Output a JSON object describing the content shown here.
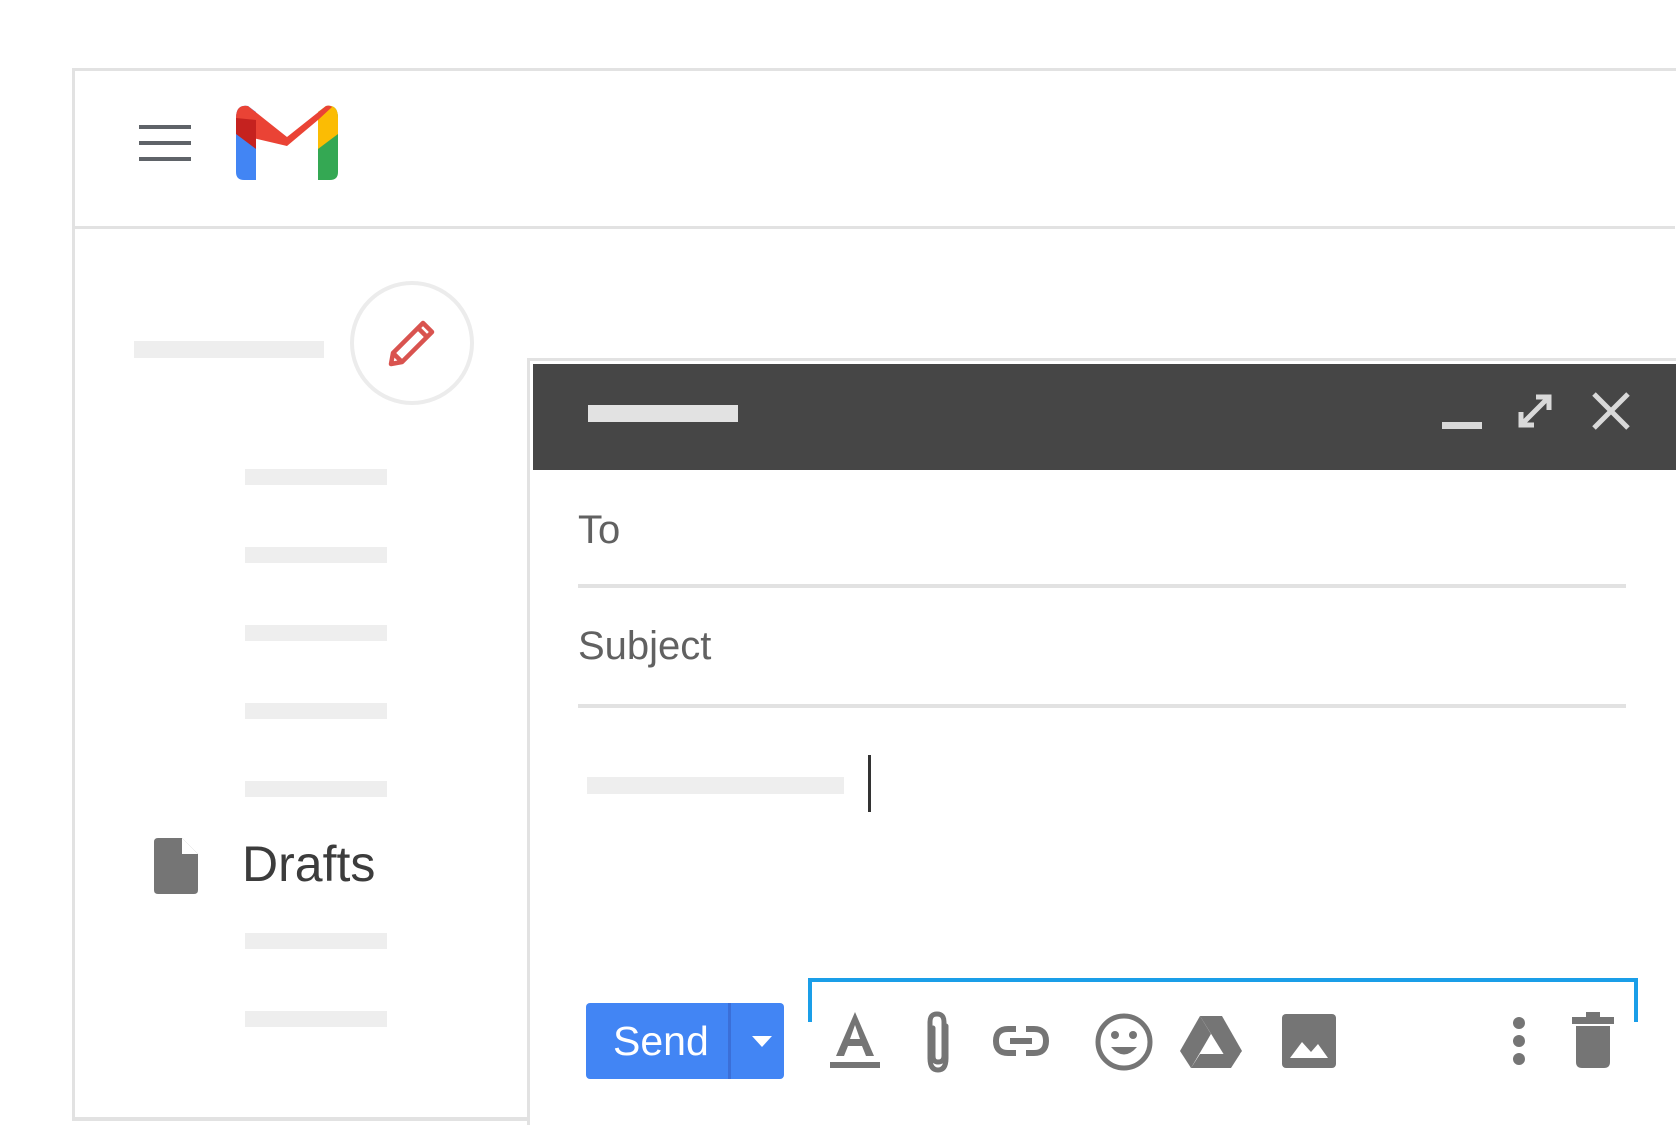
{
  "app": {
    "brand_colors": {
      "red": "#ea4335",
      "blue": "#4285f4",
      "green": "#34a853",
      "yellow": "#fbbc04"
    },
    "header": {
      "menu_icon": "hamburger-menu-icon",
      "logo": "gmail-logo"
    }
  },
  "sidebar": {
    "compose_icon": "pencil-icon",
    "drafts": {
      "label": "Drafts",
      "icon": "draft-document-icon"
    }
  },
  "compose": {
    "header": {
      "minimize_icon": "minimize-icon",
      "expand_icon": "expand-icon",
      "close_icon": "close-icon",
      "background": "#464646"
    },
    "to_label": "To",
    "subject_label": "Subject",
    "send_label": "Send",
    "send_color": "#4285f4",
    "toolbar_icons": [
      "format-text-icon",
      "attach-file-icon",
      "insert-link-icon",
      "emoji-icon",
      "google-drive-icon",
      "insert-photo-icon",
      "more-options-icon",
      "delete-icon"
    ],
    "toolbar_highlight_color": "#1a9ee8"
  }
}
